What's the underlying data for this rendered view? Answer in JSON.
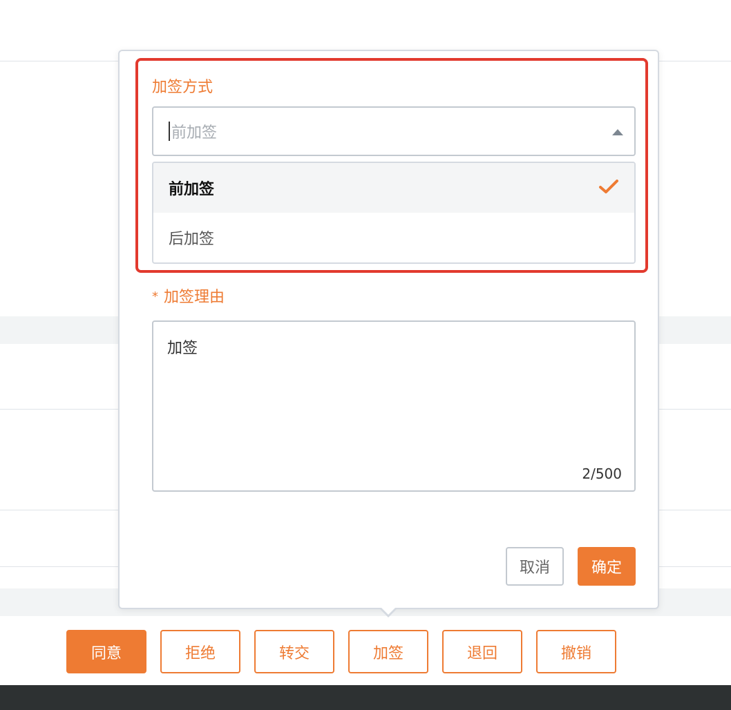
{
  "colors": {
    "accent": "#ee7b33",
    "highlight": "#e23a2e",
    "bottom_bar": "#2d3132"
  },
  "popover": {
    "method": {
      "label": "加签方式",
      "placeholder": "前加签",
      "options": [
        {
          "label": "前加签",
          "selected": true
        },
        {
          "label": "后加签",
          "selected": false
        }
      ]
    },
    "reason": {
      "required_mark": "*",
      "label": "加签理由",
      "value": "加签",
      "counter": "2/500"
    },
    "cancel_label": "取消",
    "confirm_label": "确定"
  },
  "actions": [
    "同意",
    "拒绝",
    "转交",
    "加签",
    "退回",
    "撤销"
  ],
  "icons": {
    "check": "check-icon",
    "dropdown": "caret-up-icon"
  }
}
